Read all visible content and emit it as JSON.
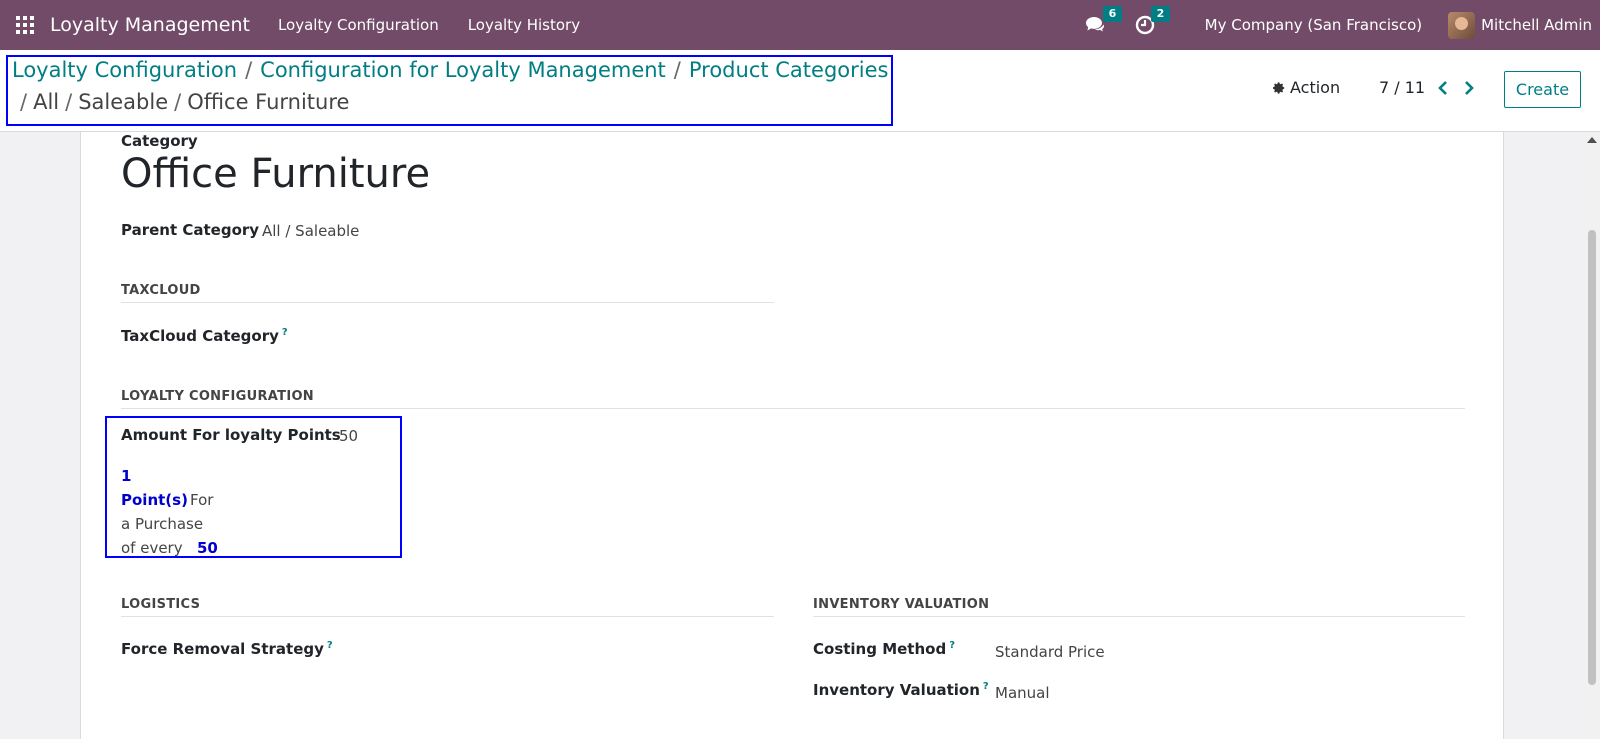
{
  "navbar": {
    "app_title": "Loyalty Management",
    "menus": [
      "Loyalty Configuration",
      "Loyalty History"
    ],
    "messages_count": "6",
    "activities_count": "2",
    "company": "My Company (San Francisco)",
    "user": "Mitchell Admin"
  },
  "breadcrumb": {
    "items": [
      "Loyalty Configuration",
      "Configuration for Loyalty Management",
      "Product Categories"
    ],
    "path": [
      "All",
      "Saleable",
      "Office Furniture"
    ]
  },
  "control": {
    "action_label": "Action",
    "pager": "7 / 11",
    "create_label": "Create"
  },
  "record": {
    "category_label": "Category",
    "name": "Office Furniture",
    "parent_label": "Parent Category",
    "parent_value": "All / Saleable"
  },
  "taxcloud": {
    "title": "TAXCLOUD",
    "category_label": "TaxCloud Category",
    "help": "?"
  },
  "loyalty": {
    "title": "LOYALTY CONFIGURATION",
    "amount_label": "Amount For loyalty Points",
    "amount_value": "50",
    "points": "1",
    "points_label": "Point(s)",
    "for_text": "For",
    "purchase_text": "a Purchase",
    "every_text": "of every",
    "every_value": "50"
  },
  "logistics": {
    "title": "LOGISTICS",
    "removal_label": "Force Removal Strategy",
    "help": "?"
  },
  "inventory": {
    "title": "INVENTORY VALUATION",
    "costing_label": "Costing Method",
    "costing_value": "Standard Price",
    "valuation_label": "Inventory Valuation",
    "valuation_value": "Manual",
    "help": "?"
  },
  "colors": {
    "navbar": "#714b67",
    "accent": "#017e84",
    "highlight_box": "#0000ff"
  }
}
